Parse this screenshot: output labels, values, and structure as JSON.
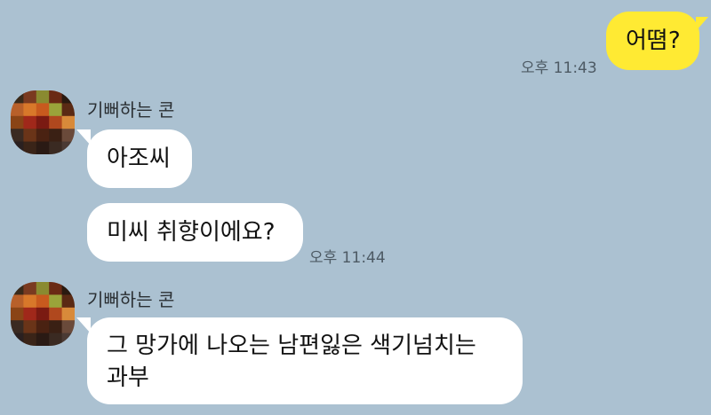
{
  "chat": {
    "messages": [
      {
        "direction": "outgoing",
        "text": "어뗨?",
        "time": "오후 11:43"
      },
      {
        "direction": "incoming",
        "sender": "기뻐하는 콘",
        "text": "아조씨"
      },
      {
        "direction": "incoming",
        "text": "미씨 취향이에요?",
        "time": "오후 11:44"
      },
      {
        "direction": "incoming",
        "sender": "기뻐하는 콘",
        "lines": [
          "그 망가에 나오는 남편잃은 색기넘치는",
          "과부"
        ]
      }
    ]
  },
  "avatar": {
    "icon": "pixelated-profile-avatar",
    "colors": [
      [
        "#3a2a1a",
        "#7a3a20",
        "#8a8a30",
        "#6a2a14",
        "#2a1a10"
      ],
      [
        "#b8602a",
        "#d8782a",
        "#c85a1e",
        "#9aa43a",
        "#5a2a14"
      ],
      [
        "#8a4416",
        "#a0281a",
        "#7a1a12",
        "#b0481e",
        "#d88a3a"
      ],
      [
        "#3a2a22",
        "#6a3418",
        "#4a2212",
        "#3a2014",
        "#6a4a3a"
      ],
      [
        "#2a2020",
        "#3a2418",
        "#2a1a14",
        "#3a2a22",
        "#4a3a34"
      ]
    ]
  }
}
